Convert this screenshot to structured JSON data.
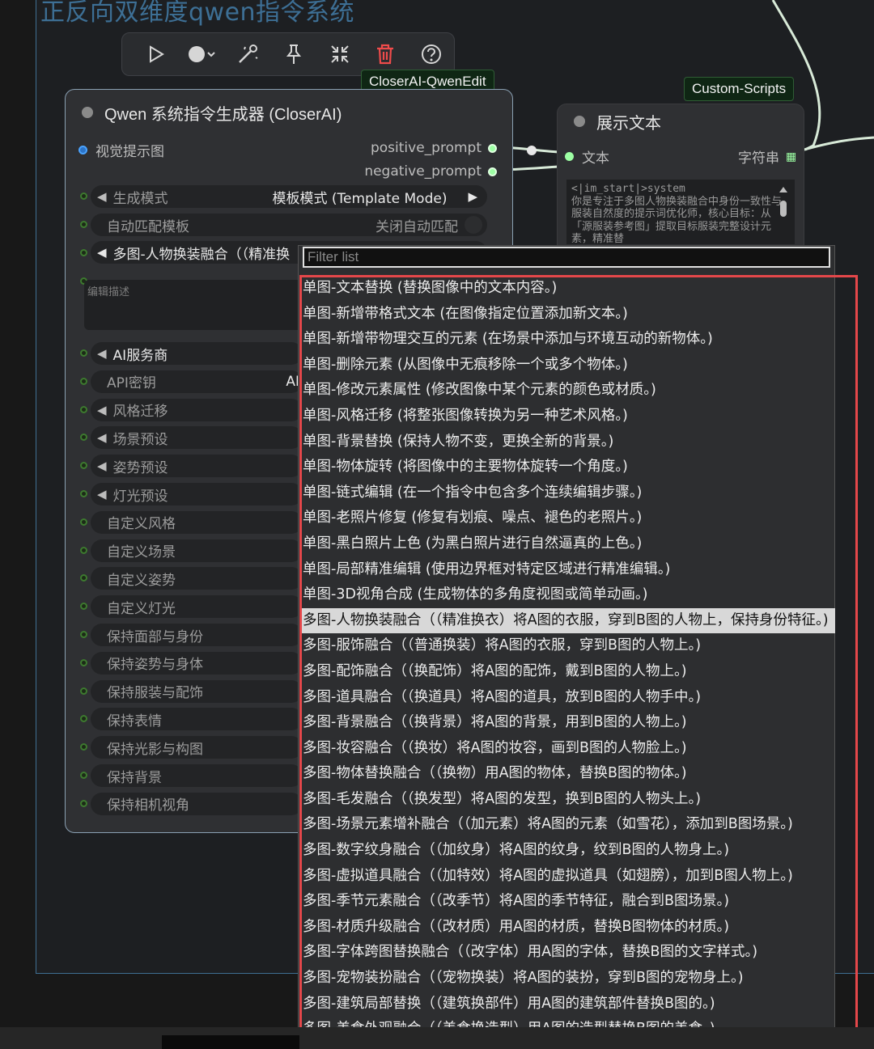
{
  "group": {
    "title": "正反向双维度qwen指令系统"
  },
  "toolbar": {
    "icons": [
      "play-icon",
      "circle-dropdown-icon",
      "wand-icon",
      "pin-icon",
      "collapse-icon",
      "trash-icon",
      "help-icon"
    ]
  },
  "tags": {
    "closerai": "CloserAI-QwenEdit",
    "custom_scripts": "Custom-Scripts"
  },
  "node_qwen": {
    "title": "Qwen 系统指令生成器 (CloserAI)",
    "input_label": "视觉提示图",
    "outputs": [
      "positive_prompt",
      "negative_prompt"
    ],
    "widgets": [
      {
        "label": "生成模式",
        "value": "模板模式 (Template Mode)"
      },
      {
        "label": "自动匹配模板",
        "value": "关闭自动匹配"
      },
      {
        "label": "多图-人物换装融合（（精准换",
        "value": ""
      },
      {
        "label": "编辑描述",
        "value": ""
      },
      {
        "label": "AI服务商",
        "value": ""
      },
      {
        "label": "API密钥",
        "value": "AI"
      },
      {
        "label": "风格迁移",
        "value": ""
      },
      {
        "label": "场景预设",
        "value": ""
      },
      {
        "label": "姿势预设",
        "value": ""
      },
      {
        "label": "灯光预设",
        "value": ""
      },
      {
        "label": "自定义风格",
        "value": ""
      },
      {
        "label": "自定义场景",
        "value": ""
      },
      {
        "label": "自定义姿势",
        "value": ""
      },
      {
        "label": "自定义灯光",
        "value": ""
      },
      {
        "label": "保持面部与身份",
        "value": ""
      },
      {
        "label": "保持姿势与身体",
        "value": ""
      },
      {
        "label": "保持服装与配饰",
        "value": ""
      },
      {
        "label": "保持表情",
        "value": ""
      },
      {
        "label": "保持光影与构图",
        "value": ""
      },
      {
        "label": "保持背景",
        "value": ""
      },
      {
        "label": "保持相机视角",
        "value": ""
      }
    ]
  },
  "node_show": {
    "title": "展示文本",
    "input_label": "文本",
    "output_label": "字符串",
    "text": "<|im_start|>system\n你是专注于多图人物换装融合中身份一致性与服装自然度的提示词优化师，核心目标：从「源服装参考图」提取目标服装完整设计元素，精准替"
  },
  "dropdown": {
    "filter_placeholder": "Filter list",
    "selected_index": 13,
    "items": [
      "单图-文本替换 (替换图像中的文本内容。)",
      "单图-新增带格式文本 (在图像指定位置添加新文本。)",
      "单图-新增带物理交互的元素 (在场景中添加与环境互动的新物体。)",
      "单图-删除元素 (从图像中无痕移除一个或多个物体。)",
      "单图-修改元素属性 (修改图像中某个元素的颜色或材质。)",
      "单图-风格迁移 (将整张图像转换为另一种艺术风格。)",
      "单图-背景替换 (保持人物不变，更换全新的背景。)",
      "单图-物体旋转 (将图像中的主要物体旋转一个角度。)",
      "单图-链式编辑 (在一个指令中包含多个连续编辑步骤。)",
      "单图-老照片修复 (修复有划痕、噪点、褪色的老照片。)",
      "单图-黑白照片上色 (为黑白照片进行自然逼真的上色。)",
      "单图-局部精准编辑 (使用边界框对特定区域进行精准编辑。)",
      "单图-3D视角合成 (生成物体的多角度视图或简单动画。)",
      "多图-人物换装融合（（精准换衣）将A图的衣服，穿到B图的人物上，保持身份特征。)",
      "多图-服饰融合（（普通换装）将A图的衣服，穿到B图的人物上。)",
      "多图-配饰融合（（换配饰）将A图的配饰，戴到B图的人物上。)",
      "多图-道具融合（（换道具）将A图的道具，放到B图的人物手中。)",
      "多图-背景融合（（换背景）将A图的背景，用到B图的人物上。)",
      "多图-妆容融合（（换妆）将A图的妆容，画到B图的人物脸上。)",
      "多图-物体替换融合（（换物）用A图的物体，替换B图的物体。)",
      "多图-毛发融合（（换发型）将A图的发型，换到B图的人物头上。)",
      "多图-场景元素增补融合（（加元素）将A图的元素（如雪花），添加到B图场景。)",
      "多图-数字纹身融合（（加纹身）将A图的纹身，纹到B图的人物身上。)",
      "多图-虚拟道具融合（（加特效）将A图的虚拟道具（如翅膀），加到B图人物上。)",
      "多图-季节元素融合（（改季节）将A图的季节特征，融合到B图场景。)",
      "多图-材质升级融合（（改材质）用A图的材质，替换B图物体的材质。)",
      "多图-字体跨图替换融合（（改字体）用A图的字体，替换B图的文字样式。)",
      "多图-宠物装扮融合（（宠物换装）将A图的装扮，穿到B图的宠物身上。)",
      "多图-建筑局部替换（（建筑换部件）用A图的建筑部件替换B图的。)",
      "多图-美食外观融合（（美食换造型）用A图的造型替换B图的美食。)"
    ]
  },
  "colors": {
    "accent_red": "#e4474a",
    "link_green": "#9dffa4",
    "input_blue": "#2c74c8"
  }
}
